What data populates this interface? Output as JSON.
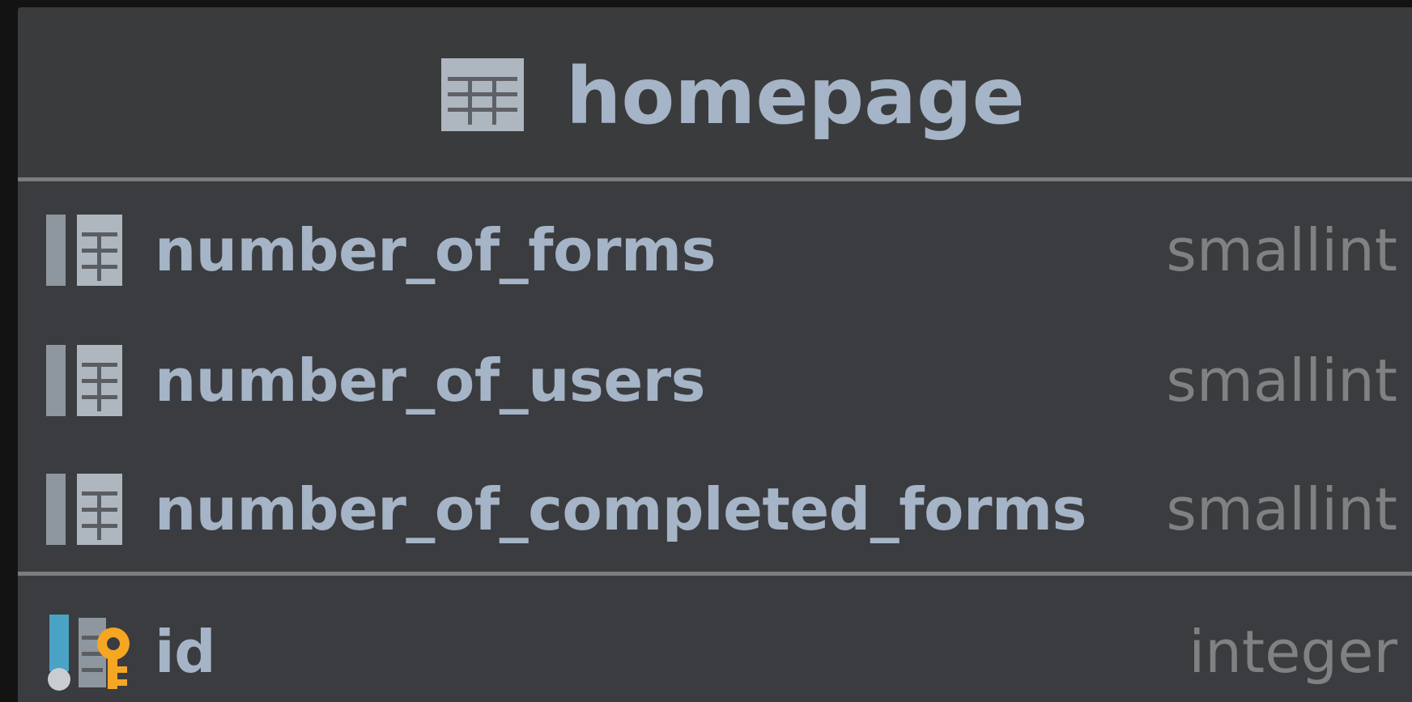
{
  "table": {
    "name": "homepage",
    "icon": "table-grid-icon"
  },
  "columns": [
    {
      "name": "number_of_forms",
      "type": "smallint",
      "icon": "column-icon"
    },
    {
      "name": "number_of_users",
      "type": "smallint",
      "icon": "column-icon"
    },
    {
      "name": "number_of_completed_forms",
      "type": "smallint",
      "icon": "column-icon"
    }
  ],
  "keys": [
    {
      "name": "id",
      "type": "integer",
      "icon": "primary-key-icon"
    }
  ],
  "colors": {
    "background": "#131314",
    "card": "#3b3c3f",
    "header": "#3a3b3c",
    "text": "#a5b4c6",
    "type_text": "#808183",
    "divider": "#7b7c7e",
    "key_blue": "#4aa3c5",
    "key_gold": "#f5a623"
  }
}
